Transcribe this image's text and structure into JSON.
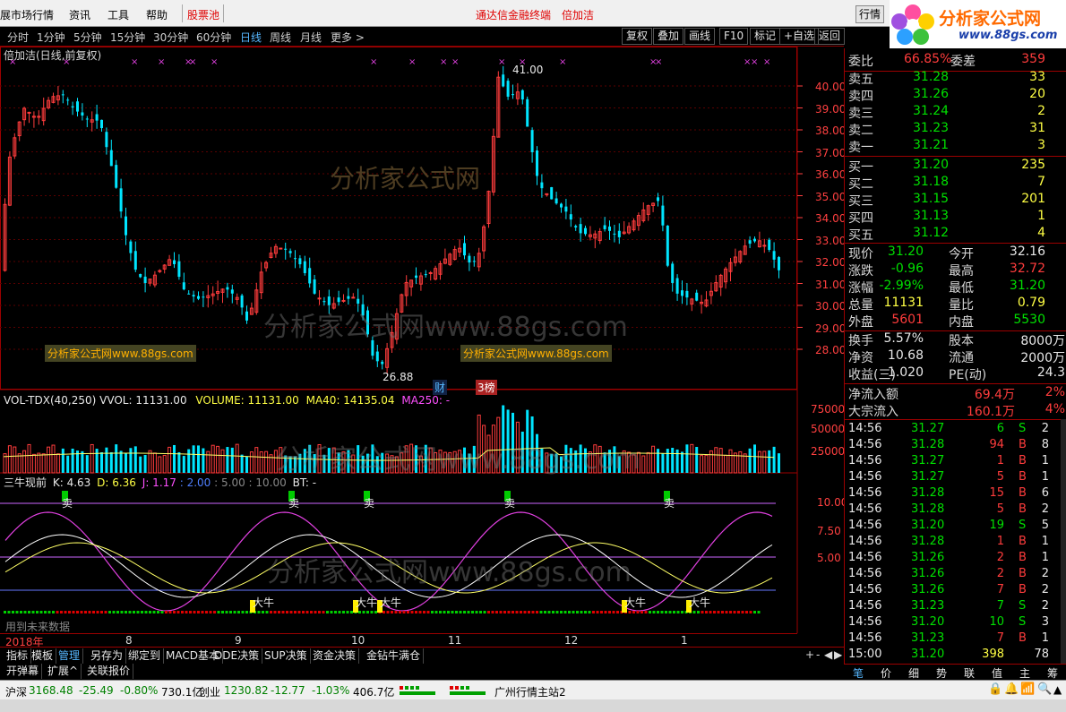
{
  "menubar": {
    "items": [
      "展市场行情",
      "资讯",
      "工具",
      "帮助"
    ],
    "stock_pool": "股票池",
    "center_title": "通达信金融终端",
    "center_stock": "倍加洁",
    "quote_button": "行情"
  },
  "logo": {
    "brand": "分析家公式网",
    "url": "www.88gs.com"
  },
  "periods": [
    "分时",
    "1分钟",
    "5分钟",
    "15分钟",
    "30分钟",
    "60分钟",
    "日线",
    "周线",
    "月线",
    "更多 >"
  ],
  "active_period": "日线",
  "toolbar_buttons": [
    "复权",
    "叠加",
    "画线",
    "F10",
    "标记",
    "+自选",
    "返回"
  ],
  "chart_title": "倍加洁(日线,前复权)",
  "price_axis": [
    "40.00",
    "39.00",
    "38.00",
    "37.00",
    "36.00",
    "35.00",
    "34.00",
    "33.00",
    "32.00",
    "31.00",
    "30.00",
    "29.00",
    "28.00"
  ],
  "annotations": {
    "high": "41.00",
    "low": "26.88",
    "fin": "财",
    "rank": "3榜"
  },
  "watermark": {
    "text": "分析家公式网",
    "url_text": "分析家公式网www.88gs.com",
    "box_text": "分析家公式网www.88gs.com"
  },
  "volume": {
    "label": "VOL-TDX(40,250)",
    "vvol": "VVOL: 11131.00",
    "volume": "VOLUME: 11131.00",
    "ma40": "MA40: 14135.04",
    "ma250": "MA250: -",
    "axis": [
      "75000",
      "50000",
      "25000"
    ]
  },
  "indicator": {
    "name": "三牛现前",
    "k": "K: 4.63",
    "d": "D: 6.36",
    "j": "J: 1.17",
    "v1": ": 2.00",
    "v2": ": 5.00",
    "v3": ": 10.00",
    "bt": "BT: -",
    "axis": [
      "10.00",
      "7.50",
      "5.00"
    ],
    "sell_label": "卖",
    "bull_label": "大牛",
    "future_note": "用到未来数据"
  },
  "xaxis": [
    "2018年",
    "8",
    "9",
    "10",
    "11",
    "12",
    "1"
  ],
  "right_panel": {
    "weibi": {
      "label": "委比",
      "value": "66.85%",
      "label2": "委差",
      "value2": "359"
    },
    "sells": [
      {
        "label": "卖五",
        "price": "31.28",
        "vol": "33"
      },
      {
        "label": "卖四",
        "price": "31.26",
        "vol": "20"
      },
      {
        "label": "卖三",
        "price": "31.24",
        "vol": "2"
      },
      {
        "label": "卖二",
        "price": "31.23",
        "vol": "31"
      },
      {
        "label": "卖一",
        "price": "31.21",
        "vol": "3"
      }
    ],
    "buys": [
      {
        "label": "买一",
        "price": "31.20",
        "vol": "235"
      },
      {
        "label": "买二",
        "price": "31.18",
        "vol": "7"
      },
      {
        "label": "买三",
        "price": "31.15",
        "vol": "201"
      },
      {
        "label": "买四",
        "price": "31.13",
        "vol": "1"
      },
      {
        "label": "买五",
        "price": "31.12",
        "vol": "4"
      }
    ],
    "stats": [
      {
        "l1": "现价",
        "v1": "31.20",
        "c1": "grn",
        "l2": "今开",
        "v2": "32.16",
        "c2": "wht"
      },
      {
        "l1": "涨跌",
        "v1": "-0.96",
        "c1": "grn",
        "l2": "最高",
        "v2": "32.72",
        "c2": "red"
      },
      {
        "l1": "涨幅",
        "v1": "-2.99%",
        "c1": "grn",
        "l2": "最低",
        "v2": "31.20",
        "c2": "grn"
      },
      {
        "l1": "总量",
        "v1": "11131",
        "c1": "yel",
        "l2": "量比",
        "v2": "0.79",
        "c2": "yel"
      },
      {
        "l1": "外盘",
        "v1": "5601",
        "c1": "red",
        "l2": "内盘",
        "v2": "5530",
        "c2": "grn"
      }
    ],
    "stats2": [
      {
        "l1": "换手",
        "v1": "5.57%",
        "c1": "wht",
        "l2": "股本",
        "v2": "8000万",
        "c2": "wht"
      },
      {
        "l1": "净资",
        "v1": "10.68",
        "c1": "wht",
        "l2": "流通",
        "v2": "2000万",
        "c2": "wht"
      },
      {
        "l1": "收益(三)",
        "v1": "1.020",
        "c1": "wht",
        "l2": "PE(动)",
        "v2": "24.3",
        "c2": "wht"
      }
    ],
    "flows": [
      {
        "label": "净流入额",
        "value": "69.4万",
        "pct": "2%"
      },
      {
        "label": "大宗流入",
        "value": "160.1万",
        "pct": "4%"
      }
    ],
    "ticks": [
      {
        "time": "14:56",
        "price": "31.27",
        "vol": "6",
        "bs": "S",
        "n": "2"
      },
      {
        "time": "14:56",
        "price": "31.28",
        "vol": "94",
        "bs": "B",
        "n": "8"
      },
      {
        "time": "14:56",
        "price": "31.27",
        "vol": "1",
        "bs": "B",
        "n": "1"
      },
      {
        "time": "14:56",
        "price": "31.27",
        "vol": "5",
        "bs": "B",
        "n": "1"
      },
      {
        "time": "14:56",
        "price": "31.28",
        "vol": "15",
        "bs": "B",
        "n": "6"
      },
      {
        "time": "14:56",
        "price": "31.28",
        "vol": "5",
        "bs": "B",
        "n": "2"
      },
      {
        "time": "14:56",
        "price": "31.20",
        "vol": "19",
        "bs": "S",
        "n": "5"
      },
      {
        "time": "14:56",
        "price": "31.28",
        "vol": "1",
        "bs": "B",
        "n": "1"
      },
      {
        "time": "14:56",
        "price": "31.26",
        "vol": "2",
        "bs": "B",
        "n": "1"
      },
      {
        "time": "14:56",
        "price": "31.26",
        "vol": "2",
        "bs": "B",
        "n": "2"
      },
      {
        "time": "14:56",
        "price": "31.26",
        "vol": "7",
        "bs": "B",
        "n": "2"
      },
      {
        "time": "14:56",
        "price": "31.23",
        "vol": "7",
        "bs": "S",
        "n": "2"
      },
      {
        "time": "14:56",
        "price": "31.20",
        "vol": "10",
        "bs": "S",
        "n": "3"
      },
      {
        "time": "14:56",
        "price": "31.23",
        "vol": "7",
        "bs": "B",
        "n": "1"
      },
      {
        "time": "15:00",
        "price": "31.20",
        "vol": "398",
        "bs": "",
        "n": "78"
      }
    ]
  },
  "bottom_tabs": [
    "指标",
    "模板",
    "管理",
    "另存为",
    "绑定到",
    "MACD基本",
    "DDE决策",
    "SUP决策",
    "资金决策",
    "金钻牛满仓"
  ],
  "active_bottom_tab": "管理",
  "bottom_tabs2": [
    "开弹幕",
    "扩展^",
    "关联报价"
  ],
  "side_tabs": [
    "笔",
    "价",
    "细",
    "势",
    "联",
    "值",
    "主",
    "筹"
  ],
  "status": {
    "sh_label": "沪深",
    "sh_value": "3168.48",
    "sh_change": "-25.49",
    "sh_pct": "-0.80%",
    "sh_amount": "730.1亿",
    "cy_label": "创业",
    "cy_value": "1230.82",
    "cy_change": "-12.77",
    "cy_pct": "-1.03%",
    "cy_amount": "406.7亿",
    "server": "广州行情主站2"
  },
  "colors": {
    "up": "#ff3c3c",
    "down": "#00e5ff",
    "grid": "#9c0000",
    "accent": "#56b7ff"
  }
}
